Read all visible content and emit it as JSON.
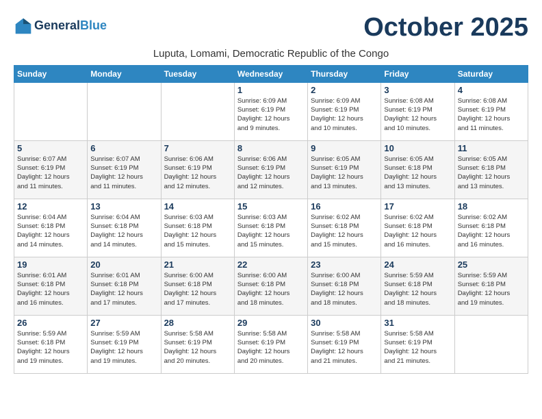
{
  "header": {
    "logo_line1": "General",
    "logo_line2": "Blue",
    "month_title": "October 2025",
    "subtitle": "Luputa, Lomami, Democratic Republic of the Congo"
  },
  "weekdays": [
    "Sunday",
    "Monday",
    "Tuesday",
    "Wednesday",
    "Thursday",
    "Friday",
    "Saturday"
  ],
  "weeks": [
    [
      {
        "day": "",
        "info": ""
      },
      {
        "day": "",
        "info": ""
      },
      {
        "day": "",
        "info": ""
      },
      {
        "day": "1",
        "info": "Sunrise: 6:09 AM\nSunset: 6:19 PM\nDaylight: 12 hours\nand 9 minutes."
      },
      {
        "day": "2",
        "info": "Sunrise: 6:09 AM\nSunset: 6:19 PM\nDaylight: 12 hours\nand 10 minutes."
      },
      {
        "day": "3",
        "info": "Sunrise: 6:08 AM\nSunset: 6:19 PM\nDaylight: 12 hours\nand 10 minutes."
      },
      {
        "day": "4",
        "info": "Sunrise: 6:08 AM\nSunset: 6:19 PM\nDaylight: 12 hours\nand 11 minutes."
      }
    ],
    [
      {
        "day": "5",
        "info": "Sunrise: 6:07 AM\nSunset: 6:19 PM\nDaylight: 12 hours\nand 11 minutes."
      },
      {
        "day": "6",
        "info": "Sunrise: 6:07 AM\nSunset: 6:19 PM\nDaylight: 12 hours\nand 11 minutes."
      },
      {
        "day": "7",
        "info": "Sunrise: 6:06 AM\nSunset: 6:19 PM\nDaylight: 12 hours\nand 12 minutes."
      },
      {
        "day": "8",
        "info": "Sunrise: 6:06 AM\nSunset: 6:19 PM\nDaylight: 12 hours\nand 12 minutes."
      },
      {
        "day": "9",
        "info": "Sunrise: 6:05 AM\nSunset: 6:19 PM\nDaylight: 12 hours\nand 13 minutes."
      },
      {
        "day": "10",
        "info": "Sunrise: 6:05 AM\nSunset: 6:18 PM\nDaylight: 12 hours\nand 13 minutes."
      },
      {
        "day": "11",
        "info": "Sunrise: 6:05 AM\nSunset: 6:18 PM\nDaylight: 12 hours\nand 13 minutes."
      }
    ],
    [
      {
        "day": "12",
        "info": "Sunrise: 6:04 AM\nSunset: 6:18 PM\nDaylight: 12 hours\nand 14 minutes."
      },
      {
        "day": "13",
        "info": "Sunrise: 6:04 AM\nSunset: 6:18 PM\nDaylight: 12 hours\nand 14 minutes."
      },
      {
        "day": "14",
        "info": "Sunrise: 6:03 AM\nSunset: 6:18 PM\nDaylight: 12 hours\nand 15 minutes."
      },
      {
        "day": "15",
        "info": "Sunrise: 6:03 AM\nSunset: 6:18 PM\nDaylight: 12 hours\nand 15 minutes."
      },
      {
        "day": "16",
        "info": "Sunrise: 6:02 AM\nSunset: 6:18 PM\nDaylight: 12 hours\nand 15 minutes."
      },
      {
        "day": "17",
        "info": "Sunrise: 6:02 AM\nSunset: 6:18 PM\nDaylight: 12 hours\nand 16 minutes."
      },
      {
        "day": "18",
        "info": "Sunrise: 6:02 AM\nSunset: 6:18 PM\nDaylight: 12 hours\nand 16 minutes."
      }
    ],
    [
      {
        "day": "19",
        "info": "Sunrise: 6:01 AM\nSunset: 6:18 PM\nDaylight: 12 hours\nand 16 minutes."
      },
      {
        "day": "20",
        "info": "Sunrise: 6:01 AM\nSunset: 6:18 PM\nDaylight: 12 hours\nand 17 minutes."
      },
      {
        "day": "21",
        "info": "Sunrise: 6:00 AM\nSunset: 6:18 PM\nDaylight: 12 hours\nand 17 minutes."
      },
      {
        "day": "22",
        "info": "Sunrise: 6:00 AM\nSunset: 6:18 PM\nDaylight: 12 hours\nand 18 minutes."
      },
      {
        "day": "23",
        "info": "Sunrise: 6:00 AM\nSunset: 6:18 PM\nDaylight: 12 hours\nand 18 minutes."
      },
      {
        "day": "24",
        "info": "Sunrise: 5:59 AM\nSunset: 6:18 PM\nDaylight: 12 hours\nand 18 minutes."
      },
      {
        "day": "25",
        "info": "Sunrise: 5:59 AM\nSunset: 6:18 PM\nDaylight: 12 hours\nand 19 minutes."
      }
    ],
    [
      {
        "day": "26",
        "info": "Sunrise: 5:59 AM\nSunset: 6:18 PM\nDaylight: 12 hours\nand 19 minutes."
      },
      {
        "day": "27",
        "info": "Sunrise: 5:59 AM\nSunset: 6:19 PM\nDaylight: 12 hours\nand 19 minutes."
      },
      {
        "day": "28",
        "info": "Sunrise: 5:58 AM\nSunset: 6:19 PM\nDaylight: 12 hours\nand 20 minutes."
      },
      {
        "day": "29",
        "info": "Sunrise: 5:58 AM\nSunset: 6:19 PM\nDaylight: 12 hours\nand 20 minutes."
      },
      {
        "day": "30",
        "info": "Sunrise: 5:58 AM\nSunset: 6:19 PM\nDaylight: 12 hours\nand 21 minutes."
      },
      {
        "day": "31",
        "info": "Sunrise: 5:58 AM\nSunset: 6:19 PM\nDaylight: 12 hours\nand 21 minutes."
      },
      {
        "day": "",
        "info": ""
      }
    ]
  ]
}
